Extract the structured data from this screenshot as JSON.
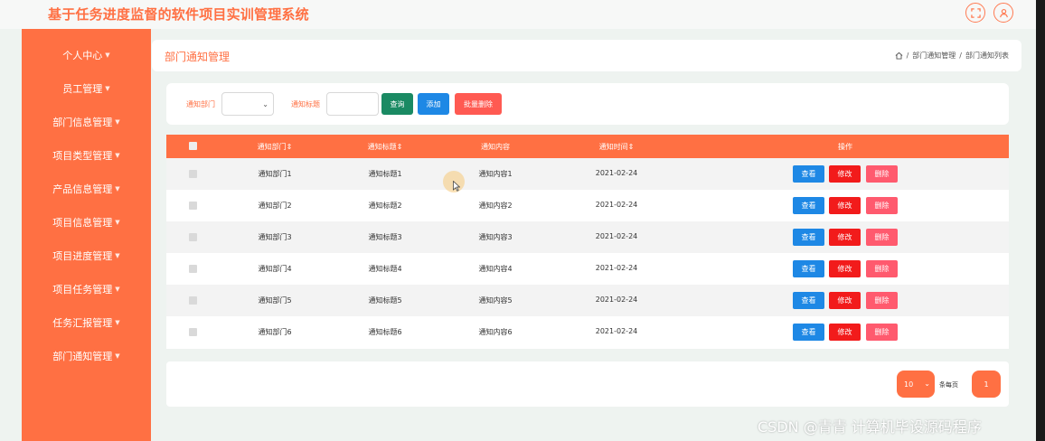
{
  "app": {
    "title": "基于任务进度监督的软件项目实训管理系统",
    "header_icons": [
      "fullscreen-icon",
      "user-icon"
    ]
  },
  "sidebar": {
    "caret": "▼",
    "items": [
      {
        "label": "个人中心"
      },
      {
        "label": "员工管理"
      },
      {
        "label": "部门信息管理"
      },
      {
        "label": "项目类型管理"
      },
      {
        "label": "产品信息管理"
      },
      {
        "label": "项目信息管理"
      },
      {
        "label": "项目进度管理"
      },
      {
        "label": "项目任务管理"
      },
      {
        "label": "任务汇报管理"
      },
      {
        "label": "部门通知管理"
      }
    ]
  },
  "page": {
    "title": "部门通知管理",
    "breadcrumb": [
      "部门通知管理",
      "部门通知列表"
    ],
    "breadcrumb_sep": "/"
  },
  "search": {
    "dept_label": "通知部门",
    "title_label": "通知标题",
    "dept_value": "",
    "title_value": "",
    "query_button": "查询",
    "add_button": "添加",
    "batch_delete_button": "批量删除"
  },
  "table": {
    "headers": [
      "通知部门⇕",
      "通知标题⇕",
      "通知内容",
      "通知时间⇕",
      "操作"
    ],
    "rows": [
      {
        "dept": "通知部门1",
        "title": "通知标题1",
        "content": "通知内容1",
        "time": "2021-02-24"
      },
      {
        "dept": "通知部门2",
        "title": "通知标题2",
        "content": "通知内容2",
        "time": "2021-02-24"
      },
      {
        "dept": "通知部门3",
        "title": "通知标题3",
        "content": "通知内容3",
        "time": "2021-02-24"
      },
      {
        "dept": "通知部门4",
        "title": "通知标题4",
        "content": "通知内容4",
        "time": "2021-02-24"
      },
      {
        "dept": "通知部门5",
        "title": "通知标题5",
        "content": "通知内容5",
        "time": "2021-02-24"
      },
      {
        "dept": "通知部门6",
        "title": "通知标题6",
        "content": "通知内容6",
        "time": "2021-02-24"
      }
    ],
    "actions": {
      "view": "查看",
      "edit": "修改",
      "delete": "删除"
    }
  },
  "pagination": {
    "page_size": "10",
    "page_size_label": "条每页",
    "current_page": "1"
  },
  "colors": {
    "primary": "#ff7043",
    "view": "#1e88e5",
    "edit": "#f21b1b",
    "delete": "#ff5a6e",
    "query": "#1a8a63",
    "add": "#1e88e5",
    "batch_delete": "#ff5a52"
  },
  "watermark": "CSDN @青青  计算机毕设源码程序"
}
